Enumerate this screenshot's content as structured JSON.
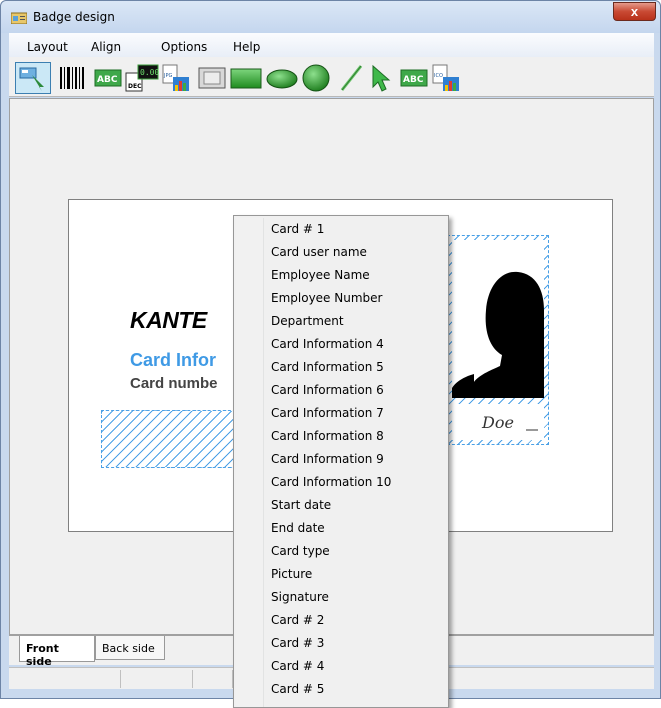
{
  "window": {
    "title": "Badge design",
    "close_label": "x"
  },
  "menu": [
    "Layout",
    "Align",
    "Options",
    "Help"
  ],
  "toolbar": {
    "tools": [
      "pointer-tool-icon",
      "barcode-icon",
      "text-icon",
      "date-icon",
      "image-icon",
      "frame-icon",
      "rectangle-icon",
      "ellipse-icon",
      "circle-icon",
      "line-icon",
      "arrow-icon",
      "text-abc-icon",
      "picture-icon"
    ],
    "date_icon_text": "DEC",
    "date_icon_digits": "0.00",
    "image_icon_text": "JPG",
    "picture_icon_text": "ICO",
    "text_icon_text": "ABC"
  },
  "card": {
    "logo_text": "KANTE",
    "info_text": "Card Infor",
    "number_text": "Card numbe",
    "signature_text": "Doe"
  },
  "context_menu": {
    "items": [
      "Card # 1",
      "Card user name",
      "Employee Name",
      "Employee Number",
      "Department",
      "Card Information 4",
      "Card Information 5",
      "Card Information 6",
      "Card Information 7",
      "Card Information 8",
      "Card Information 9",
      "Card Information 10",
      "Start date",
      "End date",
      "Card type",
      "Picture",
      "Signature",
      "Card # 2",
      "Card # 3",
      "Card # 4",
      "Card # 5"
    ]
  },
  "tabs": {
    "front": "Front side",
    "back": "Back side"
  }
}
